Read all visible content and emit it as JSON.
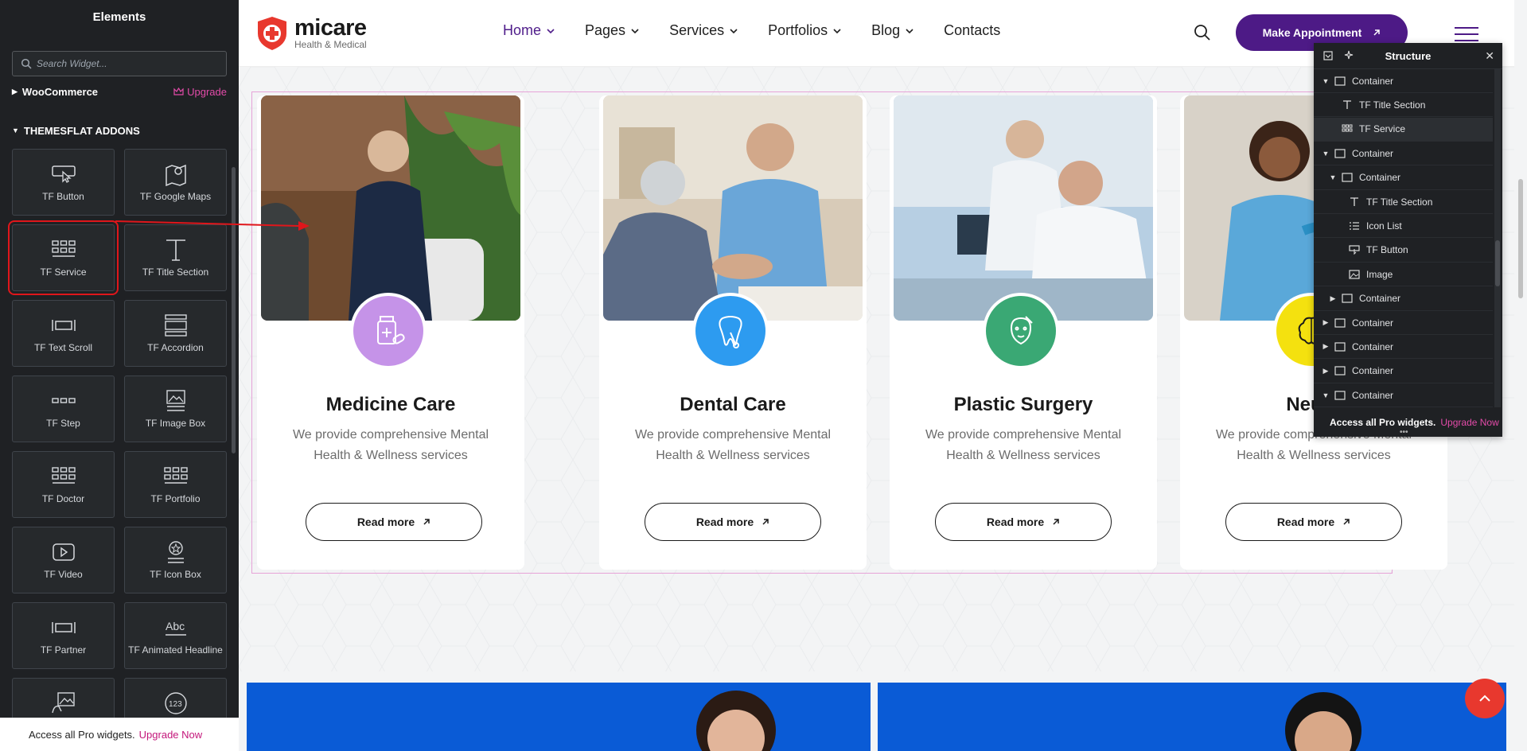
{
  "panel": {
    "title": "Elements",
    "search_placeholder": "Search Widget...",
    "categories": [
      {
        "label": "WooCommerce",
        "upgrade": "Upgrade"
      },
      {
        "label": "THEMESFLAT ADDONS"
      }
    ],
    "widgets": [
      {
        "label": "TF Button",
        "icon": "button-cursor-icon"
      },
      {
        "label": "TF Google Maps",
        "icon": "map-pin-icon"
      },
      {
        "label": "TF Service",
        "icon": "grid-icon",
        "selected": true
      },
      {
        "label": "TF Title Section",
        "icon": "title-t-icon"
      },
      {
        "label": "TF Text Scroll",
        "icon": "text-scroll-icon"
      },
      {
        "label": "TF Accordion",
        "icon": "accordion-icon"
      },
      {
        "label": "TF Step",
        "icon": "step-dots-icon"
      },
      {
        "label": "TF Image Box",
        "icon": "image-box-icon"
      },
      {
        "label": "TF Doctor",
        "icon": "grid-icon"
      },
      {
        "label": "TF Portfolio",
        "icon": "grid-icon"
      },
      {
        "label": "TF Video",
        "icon": "video-play-icon"
      },
      {
        "label": "TF Icon Box",
        "icon": "icon-box-star-icon"
      },
      {
        "label": "TF Partner",
        "icon": "partner-icon"
      },
      {
        "label": "TF Animated Headline",
        "icon": "abc-headline-icon"
      },
      {
        "label": "",
        "icon": "image-hand-icon"
      },
      {
        "label": "",
        "icon": "counter-123-icon"
      }
    ],
    "pro_bar": {
      "text": "Access all Pro widgets.",
      "link": "Upgrade Now"
    }
  },
  "header": {
    "logo": {
      "name": "micare",
      "tagline": "Health & Medical"
    },
    "nav": [
      {
        "label": "Home",
        "dropdown": true,
        "active": true
      },
      {
        "label": "Pages",
        "dropdown": true
      },
      {
        "label": "Services",
        "dropdown": true
      },
      {
        "label": "Portfolios",
        "dropdown": true
      },
      {
        "label": "Blog",
        "dropdown": true
      },
      {
        "label": "Contacts",
        "dropdown": false
      }
    ],
    "appointment_label": "Make Appointment"
  },
  "services": [
    {
      "title": "Medicine Care",
      "desc": "We provide comprehensive Mental Health & Wellness services",
      "button": "Read more",
      "badge_color": "#c593e8",
      "icon": "medicine-bottle-icon"
    },
    {
      "title": "Dental Care",
      "desc": "We provide comprehensive Mental Health & Wellness services",
      "button": "Read more",
      "badge_color": "#2d9bf0",
      "icon": "tooth-icon"
    },
    {
      "title": "Plastic Surgery",
      "desc": "We provide comprehensive Mental Health & Wellness services",
      "button": "Read more",
      "badge_color": "#3aa874",
      "icon": "face-surgery-icon"
    },
    {
      "title": "Neuro",
      "desc": "We provide comprehensive Mental Health & Wellness services",
      "button": "Read more",
      "badge_color": "#f4e10f",
      "icon": "brain-icon"
    }
  ],
  "structure": {
    "title": "Structure",
    "rows": [
      {
        "label": "Container",
        "depth": 0,
        "expanded": true,
        "icon": "container-icon"
      },
      {
        "label": "TF Title Section",
        "depth": 1,
        "icon": "title-t-icon"
      },
      {
        "label": "TF Service",
        "depth": 1,
        "icon": "grid-icon",
        "highlight": true
      },
      {
        "label": "Container",
        "depth": 0,
        "expanded": true,
        "icon": "container-icon"
      },
      {
        "label": "Container",
        "depth": 1,
        "expanded": true,
        "icon": "container-icon"
      },
      {
        "label": "TF Title Section",
        "depth": 2,
        "icon": "title-t-icon"
      },
      {
        "label": "Icon List",
        "depth": 2,
        "icon": "list-icon"
      },
      {
        "label": "TF Button",
        "depth": 2,
        "icon": "button-cursor-icon"
      },
      {
        "label": "Image",
        "depth": 2,
        "icon": "image-icon"
      },
      {
        "label": "Container",
        "depth": 1,
        "expanded": false,
        "icon": "container-icon"
      },
      {
        "label": "Container",
        "depth": 0,
        "expanded": false,
        "icon": "container-icon"
      },
      {
        "label": "Container",
        "depth": 0,
        "expanded": false,
        "icon": "container-icon"
      },
      {
        "label": "Container",
        "depth": 0,
        "expanded": false,
        "icon": "container-icon"
      },
      {
        "label": "Container",
        "depth": 0,
        "expanded": true,
        "icon": "container-icon"
      }
    ],
    "footer": {
      "text": "Access all Pro widgets.",
      "link": "Upgrade Now"
    }
  },
  "colors": {
    "brand_purple": "#4d1a86",
    "brand_red": "#e8382e",
    "selection_red": "#e0161b",
    "editor_pink": "#e34ba9"
  }
}
